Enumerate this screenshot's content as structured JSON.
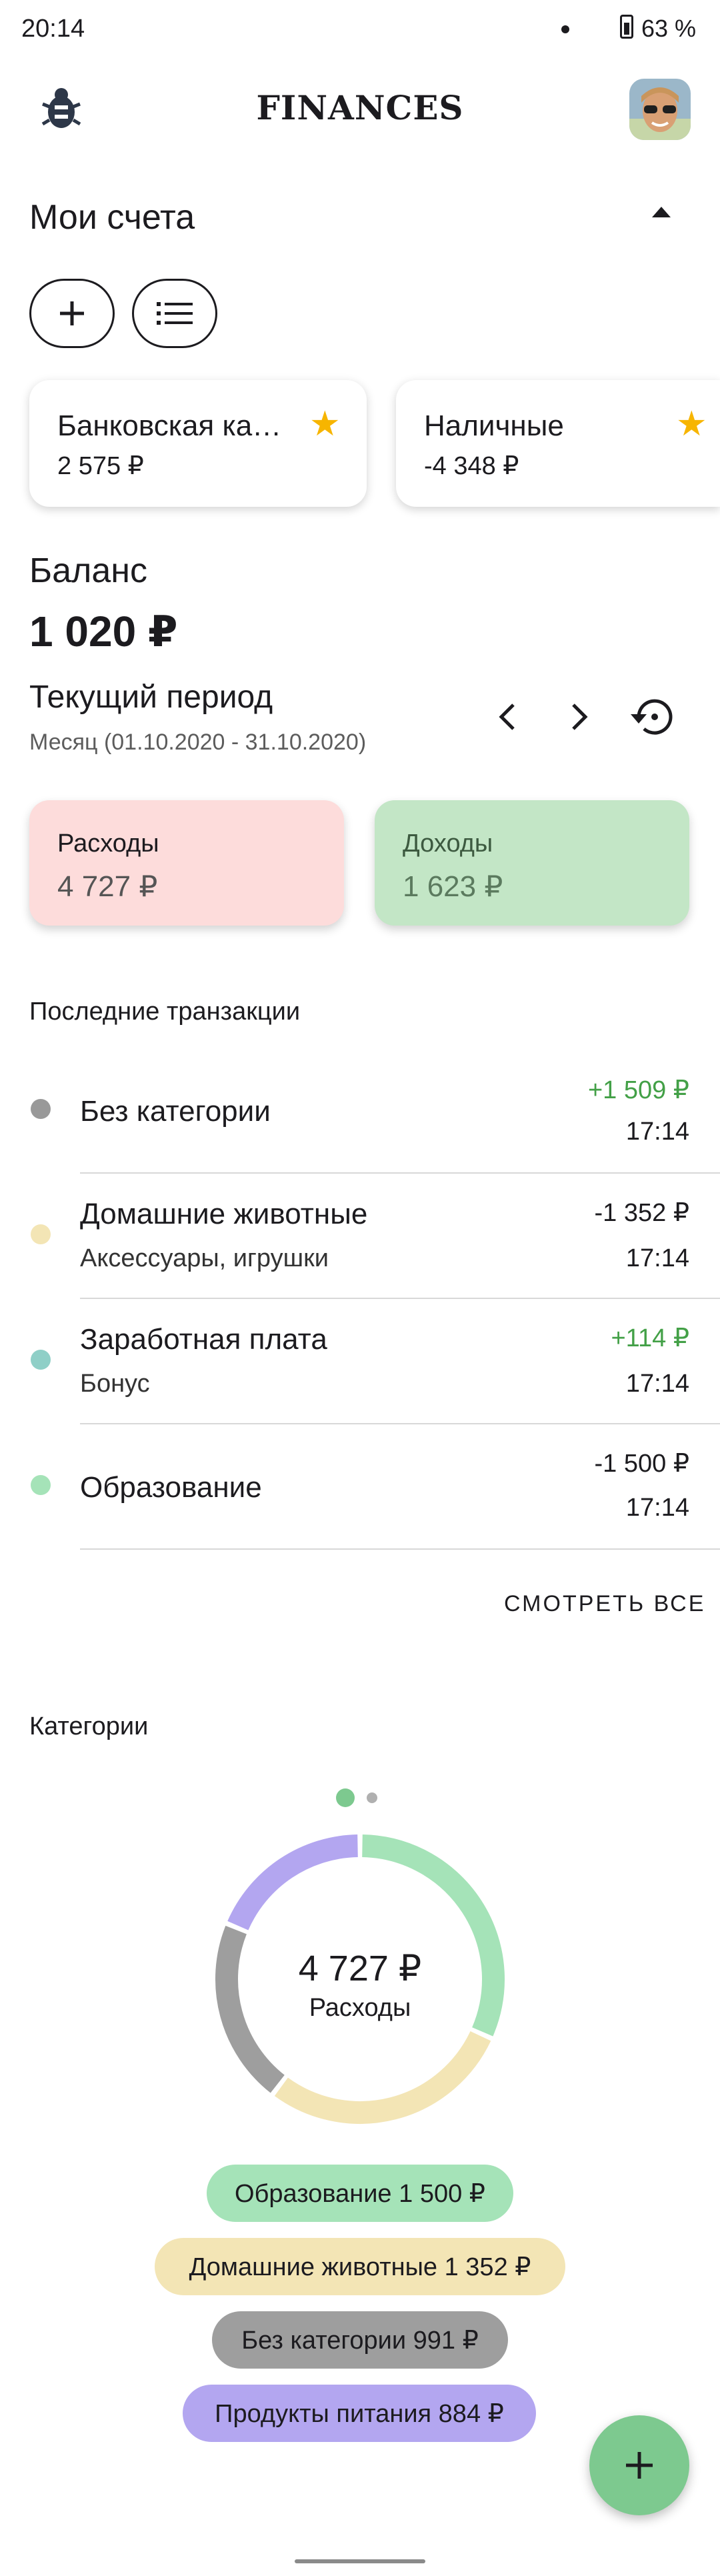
{
  "status": {
    "time": "20:14",
    "battery": "63 %"
  },
  "app": {
    "title": "FINANCES"
  },
  "accounts": {
    "heading": "Мои счета",
    "cards": [
      {
        "name": "Банковская ка…",
        "value": "2 575 ₽"
      },
      {
        "name": "Наличные",
        "value": "-4 348 ₽"
      }
    ]
  },
  "balance": {
    "heading": "Баланс",
    "value": "1 020 ₽"
  },
  "period": {
    "heading": "Текущий период",
    "range": "Месяц (01.10.2020 - 31.10.2020)"
  },
  "summary": {
    "expenses": {
      "label": "Расходы",
      "value": "4 727 ₽"
    },
    "income": {
      "label": "Доходы",
      "value": "1 623 ₽"
    }
  },
  "transactions": {
    "heading": "Последние транзакции",
    "items": [
      {
        "title": "Без категории",
        "subtitle": "",
        "amount": "+1 509 ₽",
        "time": "17:14",
        "dot_color": "#999999",
        "amount_color": "#43a047"
      },
      {
        "title": "Домашние животные",
        "subtitle": "Аксессуары, игрушки",
        "amount": "-1 352 ₽",
        "time": "17:14",
        "dot_color": "#f3e5b5",
        "amount_color": "#1c1b1f"
      },
      {
        "title": "Заработная плата",
        "subtitle": "Бонус",
        "amount": "+114 ₽",
        "time": "17:14",
        "dot_color": "#8fcfc7",
        "amount_color": "#43a047"
      },
      {
        "title": "Образование",
        "subtitle": "",
        "amount": "-1 500 ₽",
        "time": "17:14",
        "dot_color": "#a5e3b8",
        "amount_color": "#1c1b1f"
      }
    ],
    "see_all": "СМОТРЕТЬ ВСЕ"
  },
  "categories": {
    "heading": "Категории",
    "total": "4 727 ₽",
    "total_label": "Расходы",
    "items": [
      {
        "label": "Образование 1 500 ₽",
        "amount": 1500,
        "color": "#a5e3b8"
      },
      {
        "label": "Домашние животные 1 352 ₽",
        "amount": 1352,
        "color": "#f3e5b5"
      },
      {
        "label": "Без категории 991 ₽",
        "amount": 991,
        "color": "#9e9e9e"
      },
      {
        "label": "Продукты питания 884 ₽",
        "amount": 884,
        "color": "#b3a6f0"
      }
    ]
  }
}
